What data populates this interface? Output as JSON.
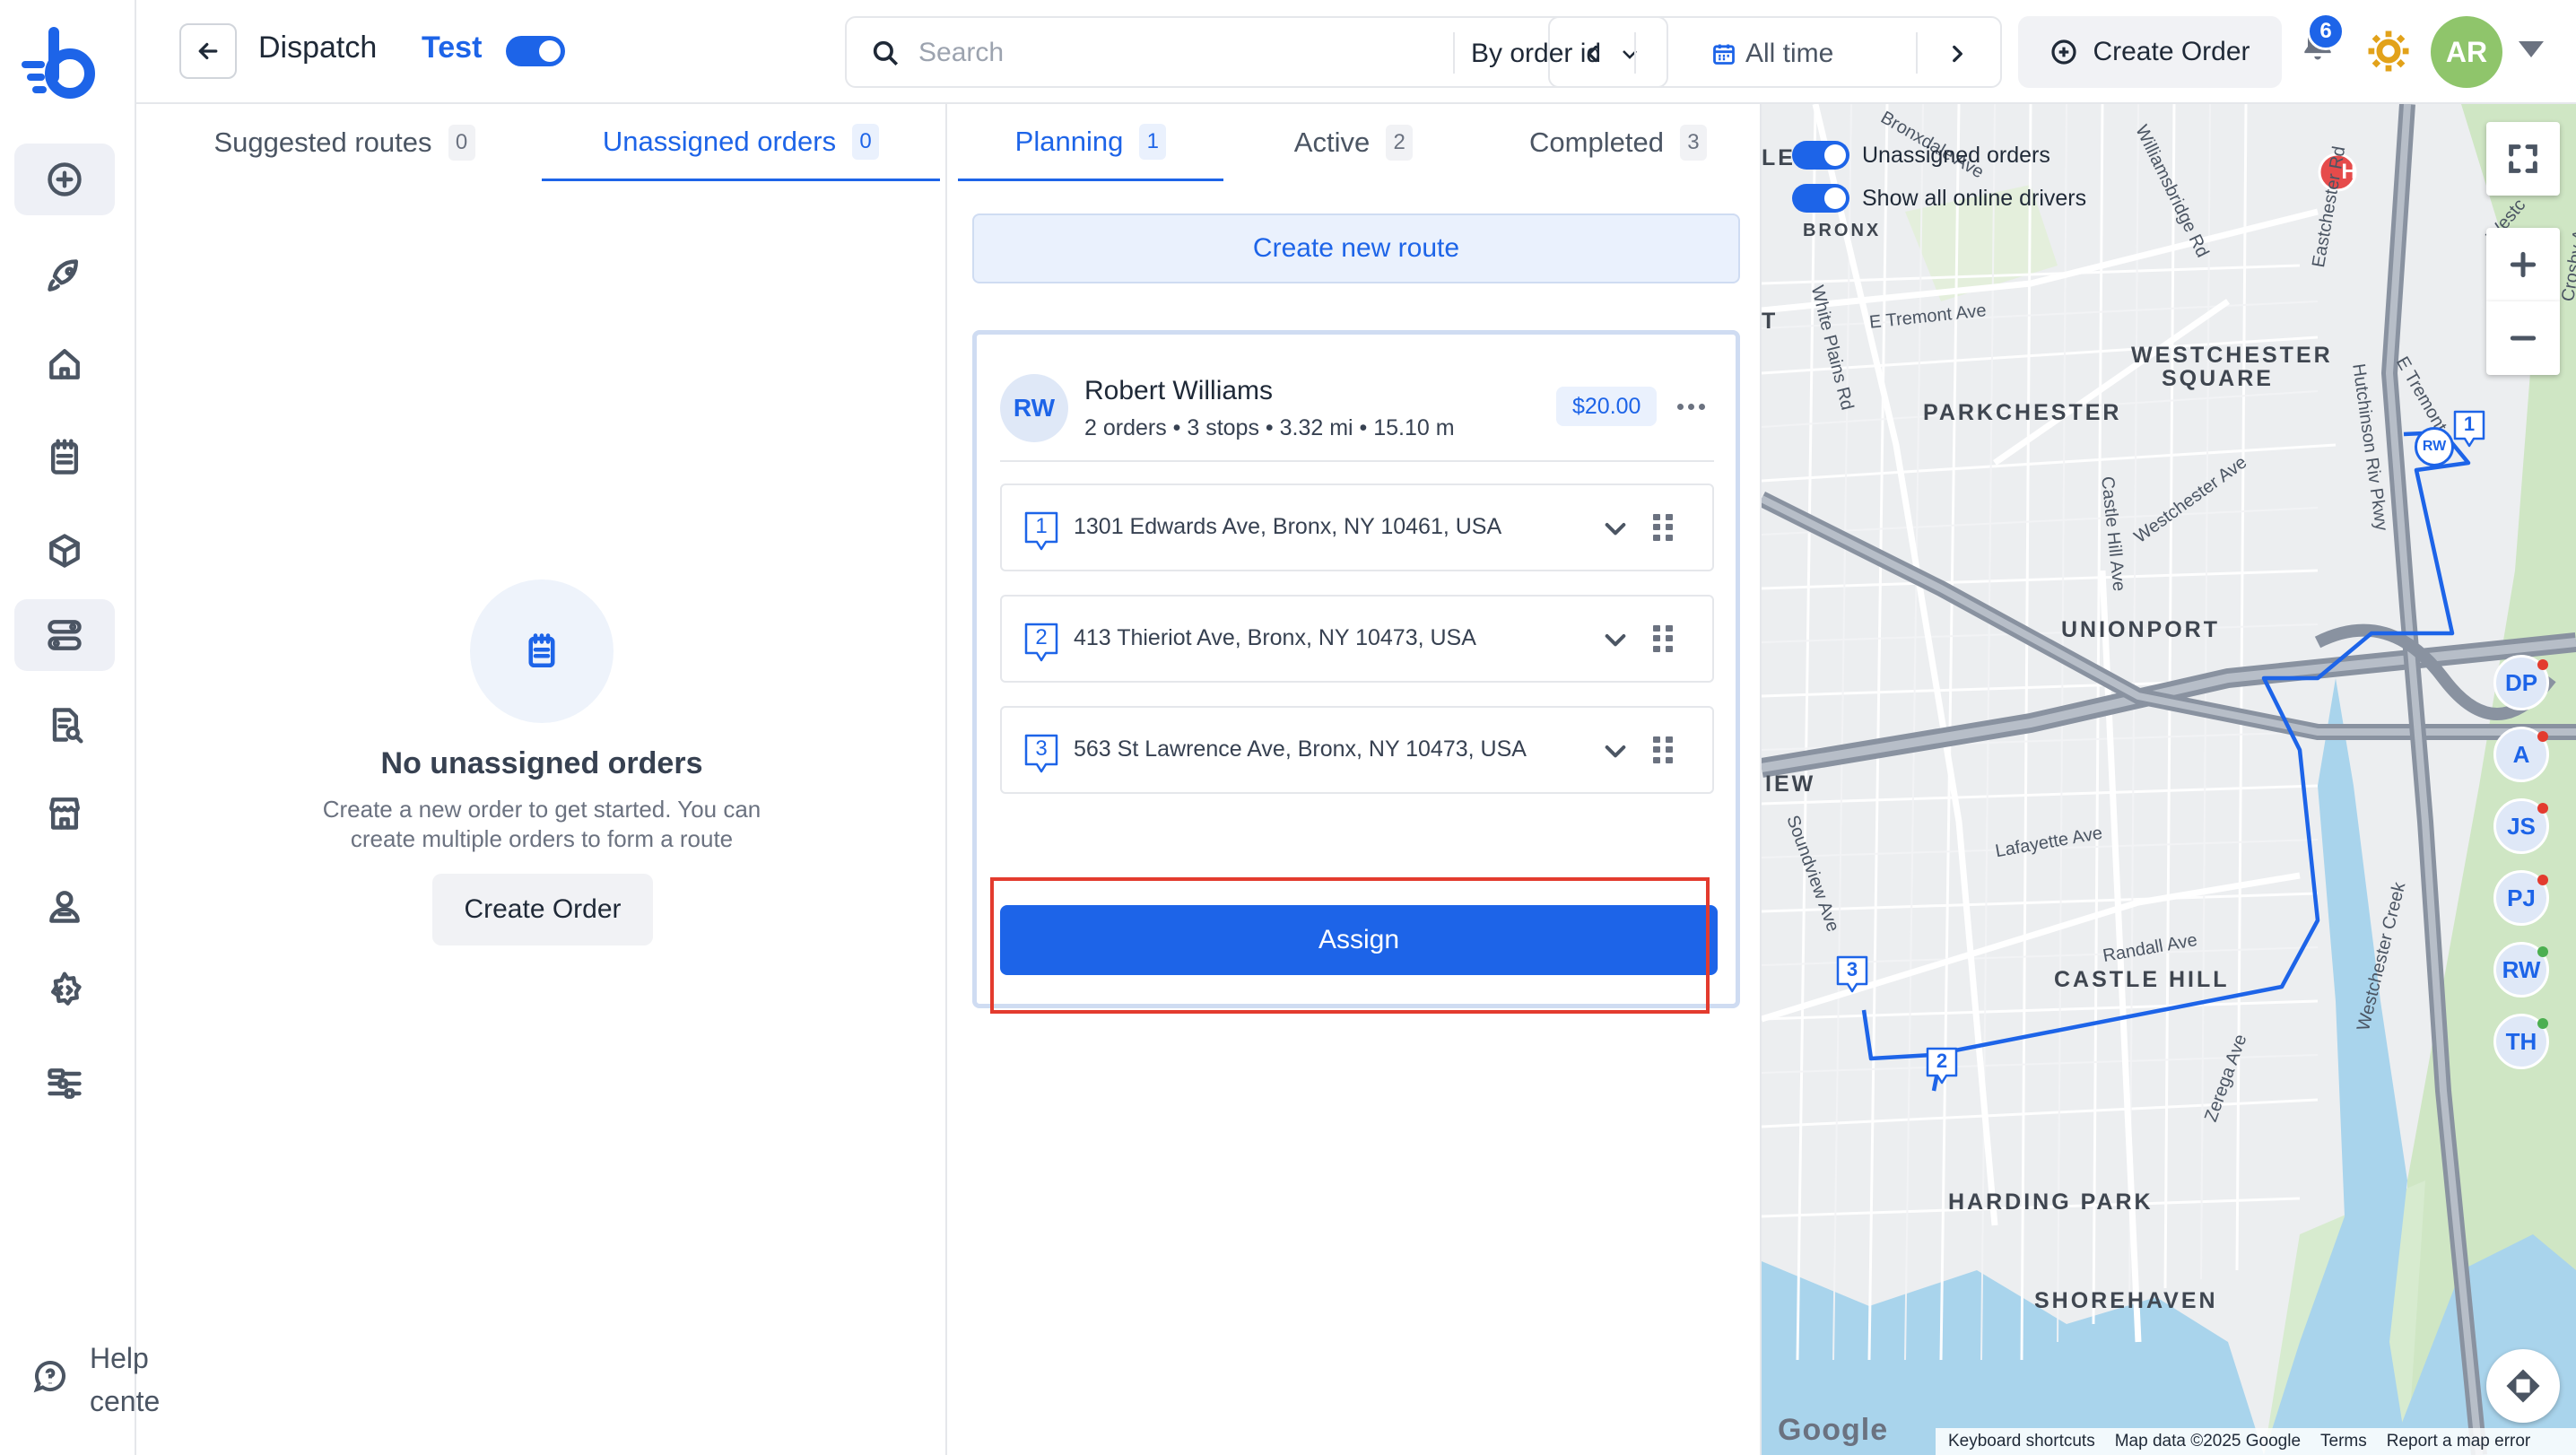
{
  "header": {
    "title": "Dispatch",
    "env_label": "Test",
    "search": {
      "placeholder": "Search",
      "mode": "By order id"
    },
    "date_range": "All time",
    "create_order_label": "Create Order",
    "notification_count": "6",
    "user_initials": "AR"
  },
  "sidebar": {
    "items": [
      "add-icon",
      "rocket-icon",
      "home-icon",
      "orders-icon",
      "package-icon",
      "routes-icon",
      "report-icon",
      "store-icon",
      "driver-icon",
      "developer-icon",
      "settings-icon"
    ],
    "active": "routes-icon",
    "help_label": "Help center"
  },
  "left_panel": {
    "tabs": [
      {
        "label": "Suggested routes",
        "count": "0"
      },
      {
        "label": "Unassigned orders",
        "count": "0"
      }
    ],
    "active_tab": "Unassigned orders",
    "empty": {
      "title": "No unassigned orders",
      "description": "Create a new order to get started. You can create multiple orders to form a route",
      "button": "Create Order"
    }
  },
  "routes_panel": {
    "tabs": [
      {
        "label": "Planning",
        "count": "1"
      },
      {
        "label": "Active",
        "count": "2"
      },
      {
        "label": "Completed",
        "count": "3"
      }
    ],
    "active_tab": "Planning",
    "create_route_label": "Create new route",
    "route": {
      "driver_initials": "RW",
      "driver_name": "Robert Williams",
      "meta": "2 orders • 3 stops • 3.32 mi • 15.10 m",
      "price": "$20.00",
      "stops": [
        {
          "number": "1",
          "address": "1301 Edwards Ave, Bronx, NY 10461, USA"
        },
        {
          "number": "2",
          "address": "413 Thieriot Ave, Bronx, NY 10473, USA"
        },
        {
          "number": "3",
          "address": "563 St Lawrence Ave, Bronx, NY 10473, USA"
        }
      ],
      "assign_label": "Assign"
    }
  },
  "map": {
    "toggles": [
      {
        "label": "Unassigned orders",
        "on": true
      },
      {
        "label": "Show all online drivers",
        "on": true
      }
    ],
    "neighborhoods": [
      "BRONX",
      "WESTCHESTER",
      "SQUARE",
      "PARKCHESTER",
      "UNIONPORT",
      "CASTLE HILL",
      "HARDING PARK",
      "SHOREHAVEN",
      "IEW",
      "LE",
      "T"
    ],
    "streets": [
      "E Tremont Ave",
      "White Plains Rd",
      "Westchester Ave",
      "Castle Hill Ave",
      "Lafayette Ave",
      "Randall Ave",
      "Soundview Ave",
      "Zerega Ave",
      "Westchester Creek",
      "Hutchinson Riv Pkwy",
      "Williamsbridge Rd",
      "Eastchester Rd",
      "Bronxdale Ave",
      "E Tremont",
      "Westc",
      "Crosby A"
    ],
    "drivers": [
      {
        "initials": "DP",
        "status_color": "#e33b2e"
      },
      {
        "initials": "A",
        "status_color": "#e33b2e"
      },
      {
        "initials": "JS",
        "status_color": "#e33b2e"
      },
      {
        "initials": "PJ",
        "status_color": "#e33b2e"
      },
      {
        "initials": "RW",
        "status_color": "#4caf50"
      },
      {
        "initials": "TH",
        "status_color": "#4caf50"
      }
    ],
    "route_marker_driver": "RW",
    "markers": [
      "1",
      "2",
      "3"
    ],
    "hospital_label": "H",
    "google_label": "Google",
    "footer": [
      "Keyboard shortcuts",
      "Map data ©2025 Google",
      "Terms",
      "Report a map error"
    ]
  },
  "colors": {
    "accent": "#1d64e8",
    "highlight": "#e33b2e",
    "avatar": "#8fc56b"
  }
}
